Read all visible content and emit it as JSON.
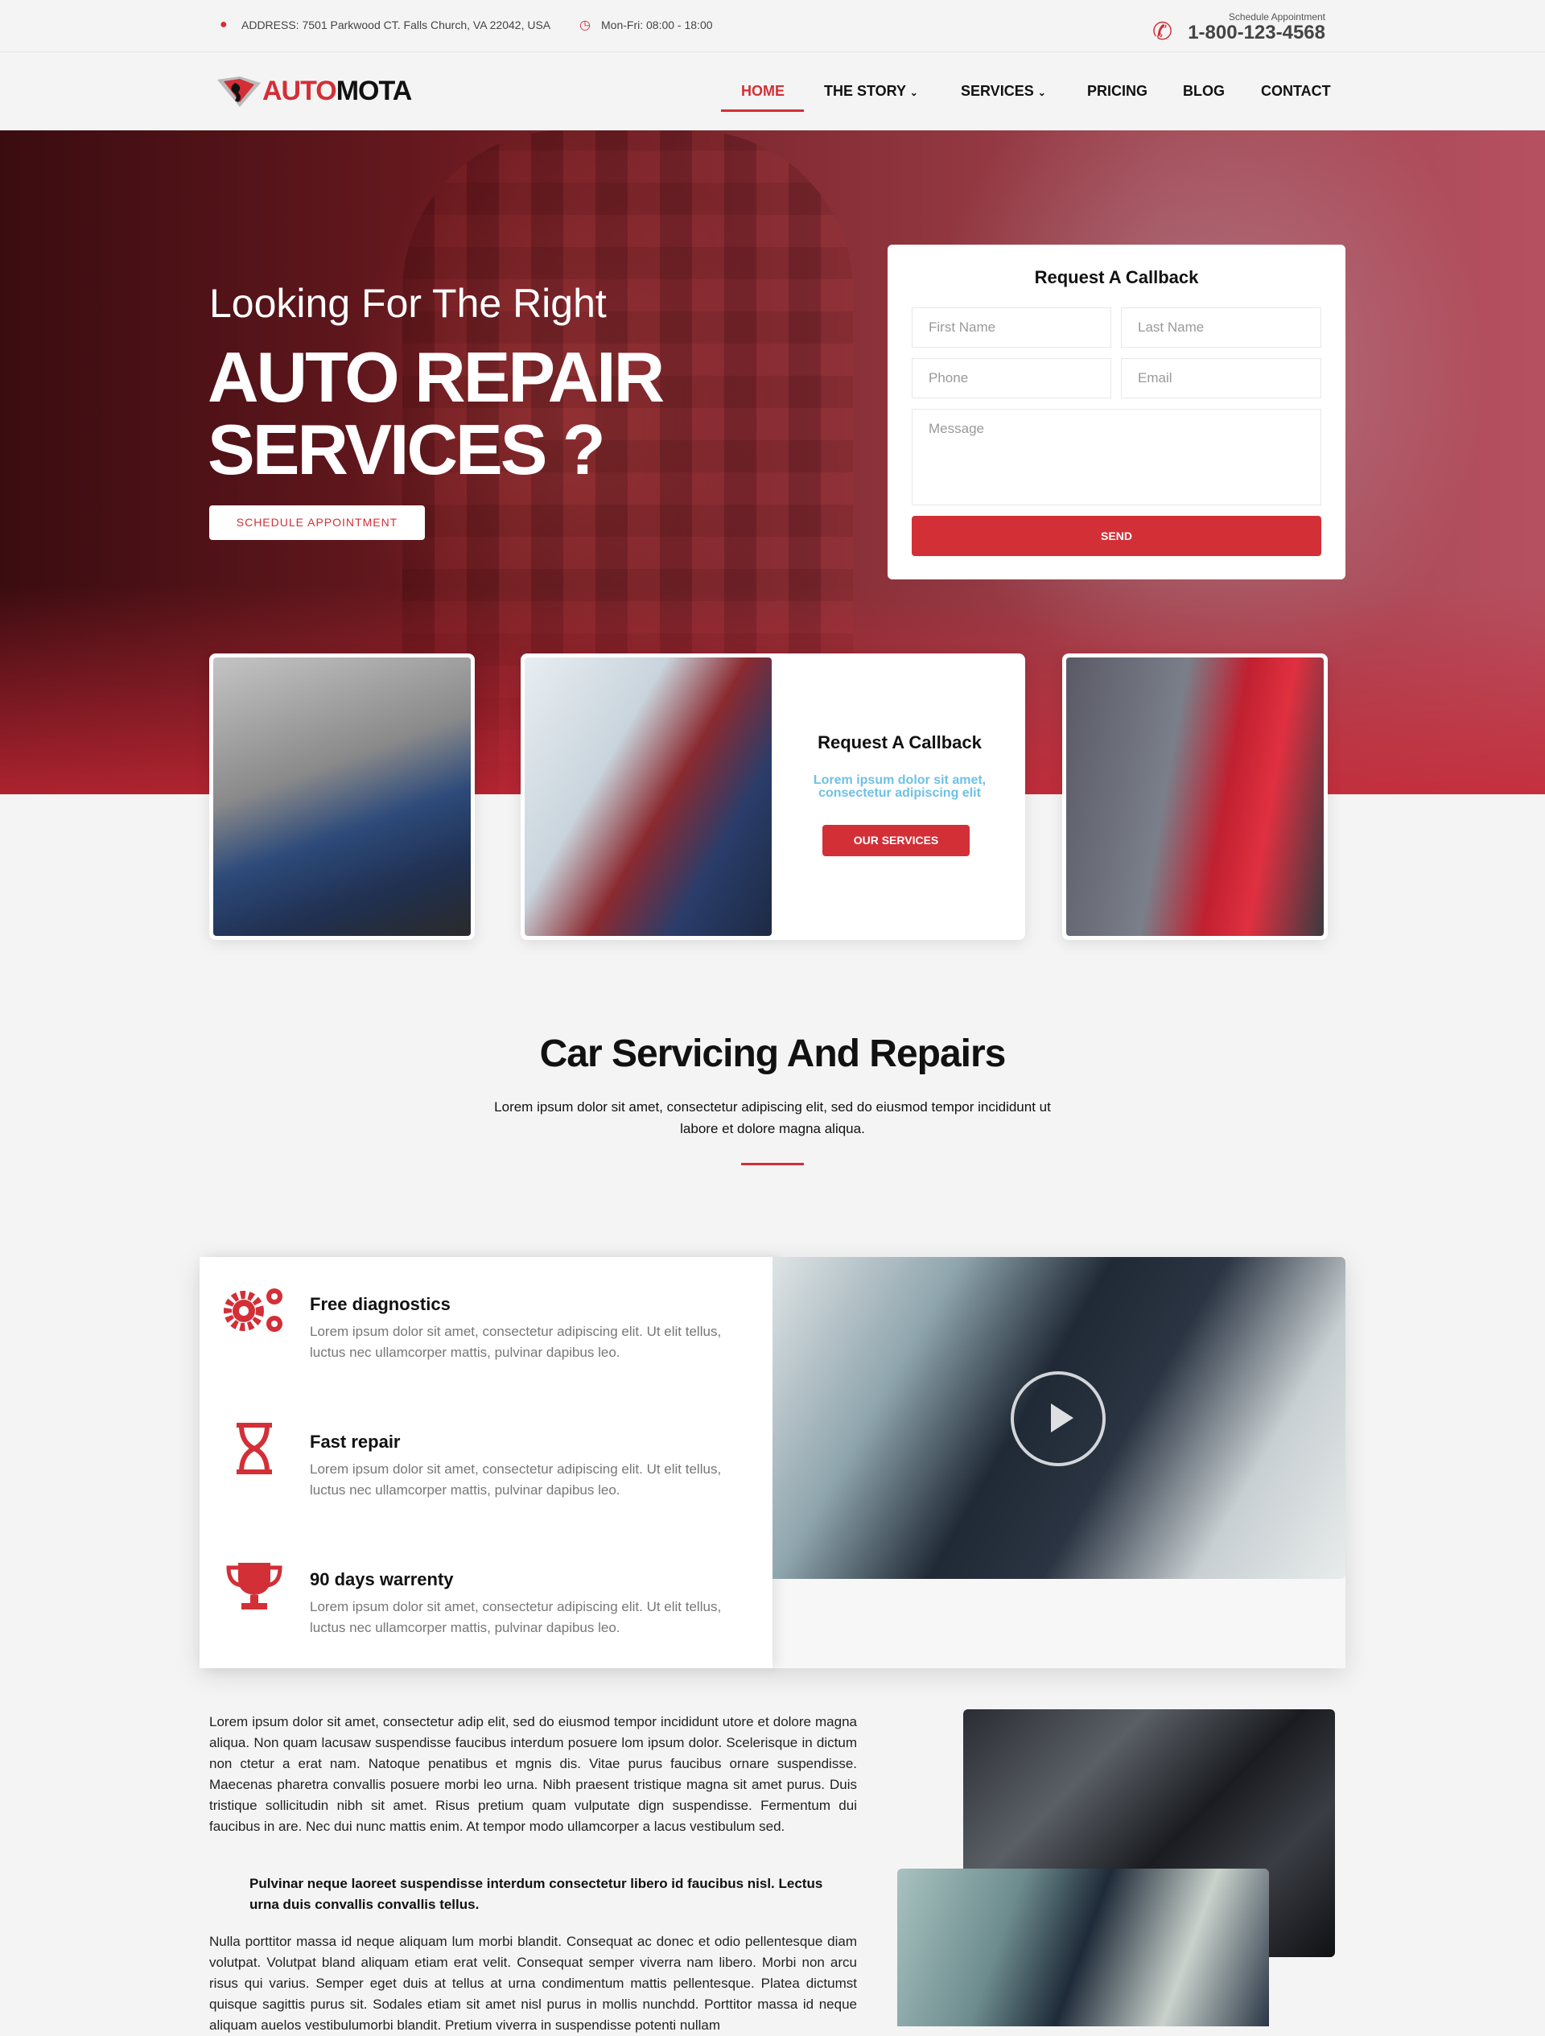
{
  "topbar": {
    "address": "ADDRESS: 7501 Parkwood CT. Falls Church, VA 22042, USA",
    "hours": "Mon-Fri: 08:00 - 18:00",
    "schedule_label": "Schedule Appointment",
    "phone": "1-800-123-4568"
  },
  "brand": {
    "part1": "AUTO",
    "part2": "MOTA"
  },
  "nav": {
    "items": [
      {
        "label": "HOME"
      },
      {
        "label": "THE STORY",
        "dropdown": true
      },
      {
        "label": "SERVICES",
        "dropdown": true
      },
      {
        "label": "PRICING"
      },
      {
        "label": "BLOG"
      },
      {
        "label": "CONTACT"
      }
    ]
  },
  "hero": {
    "subtitle": "Looking For The Right",
    "title_line1": "AUTO REPAIR",
    "title_line2": "SERVICES ?",
    "button": "SCHEDULE APPOINTMENT"
  },
  "form": {
    "title": "Request A Callback",
    "first_name": "First Name",
    "last_name": "Last Name",
    "phone": "Phone",
    "email": "Email",
    "message": "Message",
    "send": "SEND"
  },
  "promo": {
    "title": "Request A Callback",
    "text": "Lorem ipsum dolor sit amet, consectetur adipiscing elit",
    "button": "OUR SERVICES"
  },
  "section": {
    "title": "Car Servicing And Repairs",
    "text": "Lorem ipsum dolor sit amet, consectetur adipiscing elit, sed do eiusmod tempor incididunt ut labore et dolore magna aliqua."
  },
  "features": [
    {
      "icon": "gears-icon",
      "title": "Free diagnostics",
      "text": "Lorem ipsum dolor sit amet, consectetur adipiscing elit. Ut elit tellus, luctus nec ullamcorper mattis, pulvinar dapibus leo."
    },
    {
      "icon": "hourglass-icon",
      "title": "Fast repair",
      "text": "Lorem ipsum dolor sit amet, consectetur adipiscing elit. Ut elit tellus, luctus nec ullamcorper mattis, pulvinar dapibus leo."
    },
    {
      "icon": "trophy-icon",
      "title": "90 days warrenty",
      "text": "Lorem ipsum dolor sit amet, consectetur adipiscing elit. Ut elit tellus, luctus nec ullamcorper mattis, pulvinar dapibus leo."
    }
  ],
  "article": {
    "p1": "Lorem ipsum dolor sit amet, consectetur adip elit, sed do eiusmod tempor incididunt utore et dolore magna aliqua. Non quam lacusaw suspendisse faucibus interdum posuere lom ipsum dolor. Scelerisque in dictum non ctetur a erat nam. Natoque penatibus et mgnis dis. Vitae purus faucibus ornare suspendisse. Maecenas pharetra convallis posuere morbi leo urna. Nibh praesent tristique magna sit amet purus. Duis tristique sollicitudin nibh sit amet. Risus pretium quam vulputate dign suspendisse. Fermentum dui faucibus in are. Nec dui nunc mattis enim. At tempor modo ullamcorper a lacus vestibulum sed.",
    "quote": "Pulvinar neque laoreet suspendisse interdum consectetur libero id faucibus nisl. Lectus urna duis convallis convallis tellus.",
    "p2": "Nulla porttitor massa id neque aliquam lum morbi blandit. Consequat ac donec et odio pellentesque diam volutpat. Volutpat bland aliquam etiam erat velit. Consequat semper viverra nam libero. Morbi non arcu risus qui varius. Semper eget duis at tellus at urna condimentum mattis pellentesque. Platea dictumst quisque sagittis purus sit. Sodales  etiam sit amet nisl purus in mollis nunchdd. Porttitor massa id neque aliquam auelos vestibulumorbi blandit. Pretium viverra in suspendisse potenti nullam"
  },
  "colors": {
    "accent": "#d32f37",
    "promo_text": "#6ec1e4"
  }
}
